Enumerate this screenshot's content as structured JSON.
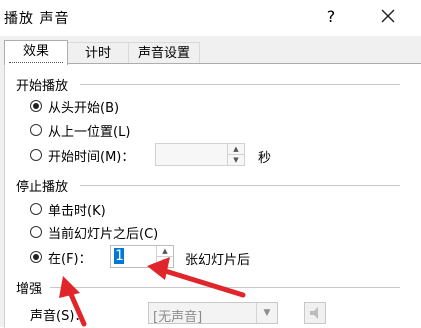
{
  "window": {
    "title": "播放 声音",
    "help_label": "?"
  },
  "tabs": [
    {
      "label": "效果"
    },
    {
      "label": "计时"
    },
    {
      "label": "声音设置"
    }
  ],
  "start_section": {
    "title": "开始播放",
    "options": [
      {
        "label": "从头开始(B)",
        "checked": true
      },
      {
        "label": "从上一位置(L)",
        "checked": false
      },
      {
        "label": "开始时间(M)：",
        "checked": false
      }
    ],
    "time_value": "",
    "time_unit": "秒"
  },
  "stop_section": {
    "title": "停止播放",
    "options": [
      {
        "label": "单击时(K)",
        "checked": false
      },
      {
        "label": "当前幻灯片之后(C)",
        "checked": false
      },
      {
        "label": "在(F)：",
        "checked": true
      }
    ],
    "slides_value": "1",
    "slides_suffix": "张幻灯片后"
  },
  "enhance_section": {
    "title": "增强",
    "sound_label": "声音(S)：",
    "sound_value": "[无声音]"
  },
  "colors": {
    "annotation_arrow": "#e0262b",
    "selection": "#0078d7"
  }
}
